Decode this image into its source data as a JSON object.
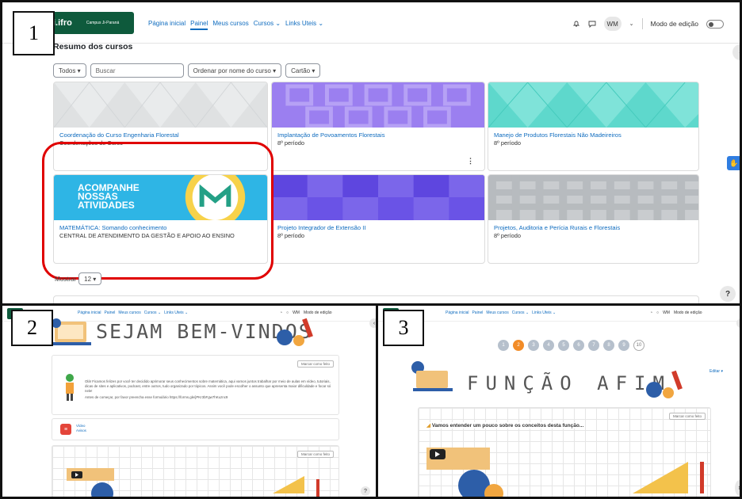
{
  "labels": {
    "n1": "1",
    "n2": "2",
    "n3": "3"
  },
  "nav": {
    "logo": "i.ifro",
    "logo_sub": "Campus Ji-Paraná",
    "links": [
      "Página inicial",
      "Painel",
      "Meus cursos",
      "Cursos ⌄",
      "Links Uteis ⌄"
    ],
    "avatar": "WM",
    "edit_mode": "Modo de edição"
  },
  "dashboard": {
    "title": "Resumo dos cursos",
    "filters": {
      "all": "Todos ▾",
      "search_placeholder": "Buscar",
      "sort": "Ordenar por nome do curso ▾",
      "view": "Cartão ▾"
    },
    "courses": [
      {
        "title": "Coordenação do Curso Engenharia Florestal",
        "subtitle": "Coordenações de Curso"
      },
      {
        "title": "Implantação de Povoamentos Florestais",
        "subtitle": "8º período"
      },
      {
        "title": "Manejo de Produtos Florestais Não Madeireiros",
        "subtitle": "8º período"
      },
      {
        "title": "MATEMÁTICA: Somando conhecimento",
        "subtitle": "CENTRAL DE ATENDIMENTO DA GESTÃO E APOIO AO ENSINO",
        "banner_lines": [
          "ACOMPANHE",
          "NOSSAS",
          "ATIVIDADES"
        ]
      },
      {
        "title": "Projeto Integrador de Extensão II",
        "subtitle": "8º período"
      },
      {
        "title": "Projetos, Auditoria e Perícia Rurais e Florestais",
        "subtitle": "8º período"
      }
    ],
    "show_label": "Mostrar",
    "show_value": "12 ▾",
    "help": "?"
  },
  "panel2": {
    "heading": "SEJAM BEM-VINDOS",
    "mark_done": "Marcar como feito",
    "welcome_text": "Olá! Ficamos felizes por você ter decidido aprimorar seus conhecimentos sobre matemática, aqui vamos juntos trabalhar por meio de aulas em vídeo, tutoriais, dicas de sites e aplicativos, podcast, entre outros, tudo organizado por tópicos. Assim você pode escolher o assunto que apresenta maior dificuldade e focar só nele!",
    "form_text": "Antes de começar, por favor preencha esse formulário https://forms.gle/jPKr3bFgw7hKuznc9",
    "item_label": "Vídeo",
    "item_sub": "Avisos"
  },
  "panel3": {
    "pages": [
      "1",
      "2",
      "3",
      "4",
      "5",
      "6",
      "7",
      "8",
      "9",
      "10"
    ],
    "active_page": 2,
    "heading": "FUNÇÃO AFIM",
    "edit": "Editar ▾",
    "mark_done": "Marcar como feito",
    "intro": "Vamos entender um pouco sobre os conceitos desta função..."
  },
  "colors": {
    "brand": "#0e5a3c",
    "link": "#0f6cbf",
    "highlight": "#e00000",
    "pager_active": "#f28c28"
  }
}
